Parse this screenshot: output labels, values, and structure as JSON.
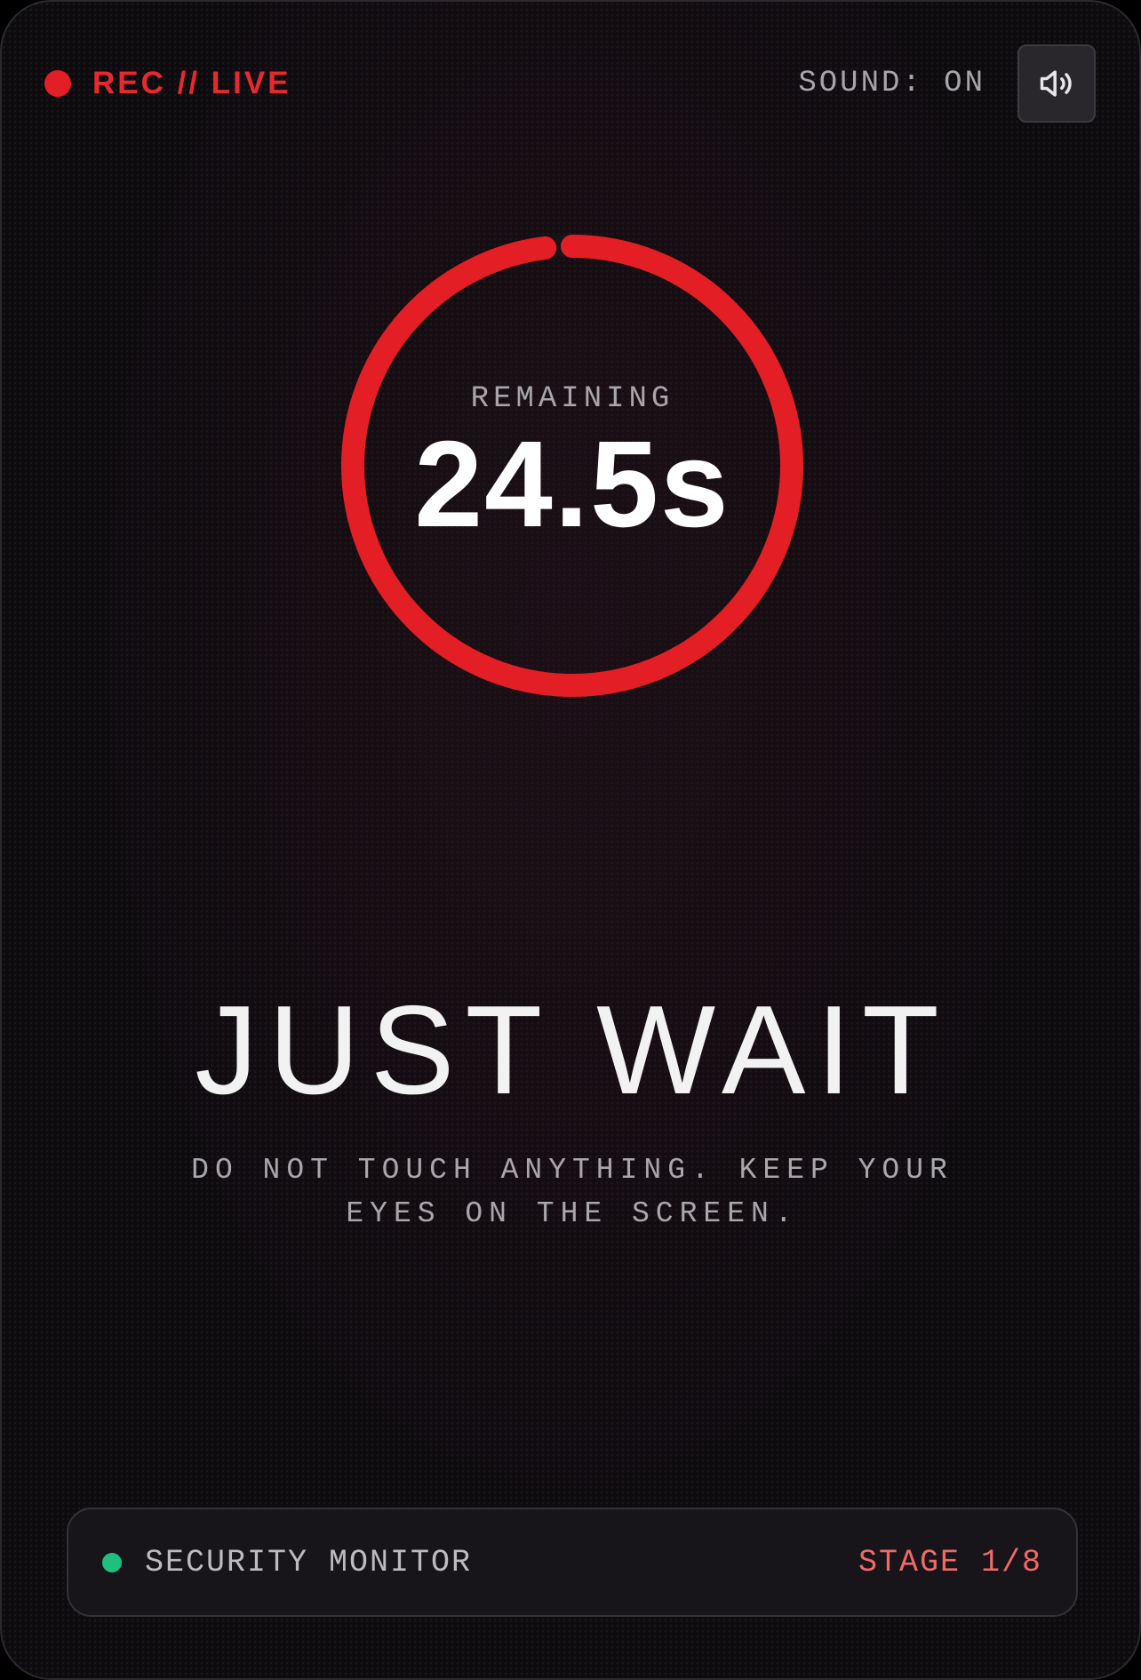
{
  "header": {
    "rec_label": "REC // LIVE",
    "sound_label": "SOUND: ON",
    "sound_icon": "speaker-volume-icon"
  },
  "timer": {
    "label": "REMAINING",
    "value": "24.5s",
    "progress_fraction": 0.98
  },
  "main": {
    "headline": "JUST WAIT",
    "instruction": "DO NOT TOUCH ANYTHING. KEEP YOUR EYES ON THE SCREEN."
  },
  "footer": {
    "monitor_label": "SECURITY MONITOR",
    "stage_label": "STAGE 1/8"
  },
  "colors": {
    "accent_red": "#e31e24",
    "status_green": "#1fbf7d",
    "stage_text": "#f06a6a",
    "background": "#0e0b0f"
  }
}
